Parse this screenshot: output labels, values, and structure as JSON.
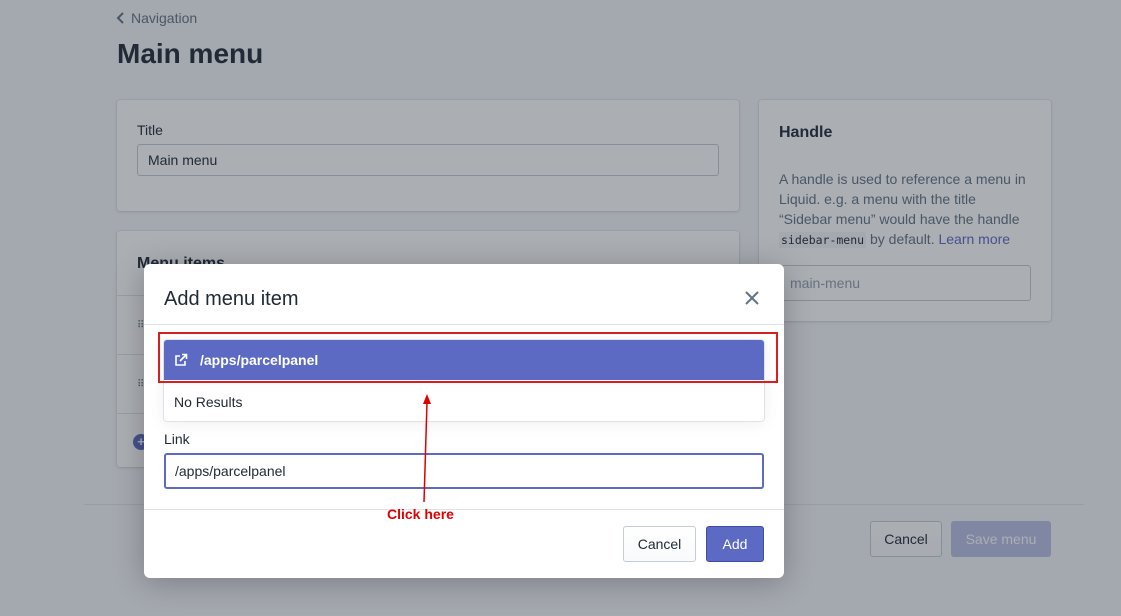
{
  "page": {
    "back_label": "Navigation",
    "title": "Main menu"
  },
  "title_card": {
    "label": "Title",
    "value": "Main menu"
  },
  "menu_card": {
    "header": "Menu items"
  },
  "handle_card": {
    "header": "Handle",
    "desc_before": "A handle is used to reference a menu in Liquid. e.g. a menu with the title “Sidebar menu” would have the handle ",
    "code": "sidebar-menu",
    "desc_after": " by default. ",
    "learn_more": "Learn more",
    "input_value": "main-menu"
  },
  "footer": {
    "cancel_label": "Cancel",
    "save_label": "Save menu"
  },
  "modal": {
    "title": "Add menu item",
    "suggestion": "/apps/parcelpanel",
    "no_results": "No Results",
    "link_label": "Link",
    "link_value": "/apps/parcelpanel",
    "cancel_label": "Cancel",
    "add_label": "Add"
  },
  "annotation": {
    "text": "Click here",
    "color": "#e00000"
  },
  "colors": {
    "accent": "#5c6ac4",
    "highlight": "#d91e1e"
  }
}
